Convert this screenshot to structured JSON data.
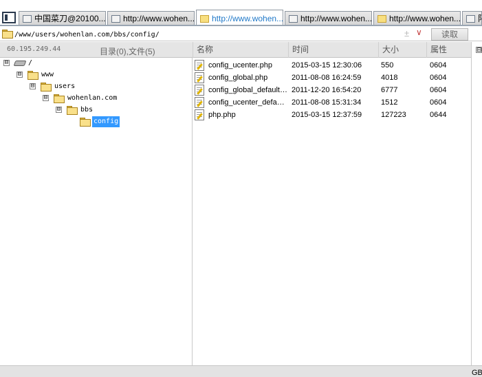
{
  "tabs": [
    {
      "label": "中国菜刀@20100...",
      "icon": "window-icon",
      "active": false
    },
    {
      "label": "http://www.wohen...",
      "icon": "window-icon",
      "active": false
    },
    {
      "label": "http://www.wohen...",
      "icon": "folder-icon",
      "active": true
    },
    {
      "label": "http://www.wohen...",
      "icon": "window-icon",
      "active": false
    },
    {
      "label": "http://www.wohen...",
      "icon": "folder-icon",
      "active": false
    },
    {
      "label": "阳",
      "icon": "window-icon",
      "active": false
    }
  ],
  "address": {
    "value": "/www/users/wohenlan.com/bbs/config/",
    "add_symbol": "±",
    "dropdown_symbol": "∨",
    "read_label": "读取"
  },
  "header": {
    "ip": "60.195.249.44",
    "count": "目录(0),文件(5)",
    "columns": {
      "name": "名称",
      "time": "时间",
      "size": "大小",
      "attr": "属性"
    }
  },
  "tree": {
    "toggle_symbol": "⊟",
    "nodes": [
      {
        "label": "/",
        "type": "drive"
      },
      {
        "label": "www",
        "type": "folder"
      },
      {
        "label": "users",
        "type": "folder"
      },
      {
        "label": "wohenlan.com",
        "type": "folder"
      },
      {
        "label": "bbs",
        "type": "folder"
      },
      {
        "label": "config",
        "type": "folder",
        "selected": true
      }
    ]
  },
  "files": [
    {
      "name": "config_ucenter.php",
      "time": "2015-03-15 12:30:06",
      "size": "550",
      "attr": "0604"
    },
    {
      "name": "config_global.php",
      "time": "2011-08-08 16:24:59",
      "size": "4018",
      "attr": "0604"
    },
    {
      "name": "config_global_default....",
      "time": "2011-12-20 16:54:20",
      "size": "6777",
      "attr": "0604"
    },
    {
      "name": "config_ucenter_default...",
      "time": "2011-08-08 15:31:34",
      "size": "1512",
      "attr": "0604"
    },
    {
      "name": "php.php",
      "time": "2015-03-15 12:37:59",
      "size": "127223",
      "attr": "0644"
    }
  ],
  "right_pane": {
    "toggle_symbol": "⊟"
  },
  "status": {
    "encoding": "GB"
  }
}
